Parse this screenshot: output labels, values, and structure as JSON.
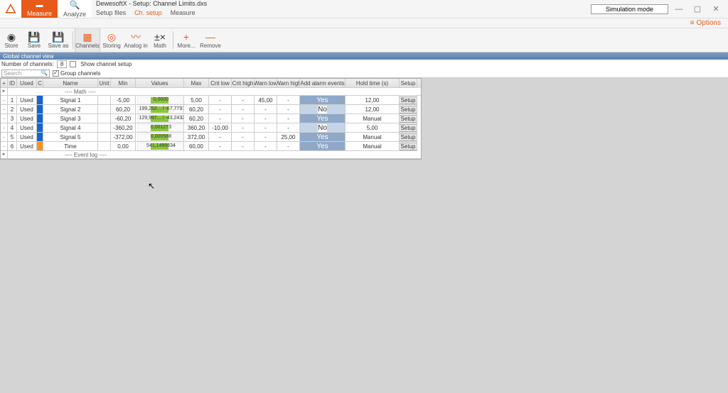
{
  "titlebar": {
    "app_title": "DewesoftX - Setup: Channel Limits.dxs",
    "measure": "Measure",
    "analyze": "Analyze",
    "setup_files": "Setup files",
    "ch_setup": "Ch. setup",
    "measure2": "Measure",
    "sim_mode": "Simulation mode",
    "options": "Options"
  },
  "toolbar": {
    "store": "Store",
    "save": "Save",
    "save_as": "Save as",
    "channels": "Channels",
    "storing": "Storing",
    "analog_in": "Analog in",
    "math": "Math",
    "more": "More...",
    "remove": "Remove"
  },
  "channel_hdr": "Global channel view",
  "controls": {
    "num_channels_lbl": "Number of channels:",
    "num_channels_val": "8",
    "show_channel_setup": "Show channel setup",
    "search_placeholder": "Search",
    "group_channels": "Group channels"
  },
  "columns": {
    "plus": "+",
    "id": "ID",
    "used": "Used",
    "c": "C",
    "name": "Name",
    "unit": "Unit",
    "min": "Min",
    "values": "Values",
    "max": "Max",
    "crit_low": "Crit low",
    "crit_high": "Crit high",
    "warn_low": "Warn low",
    "warn_high": "Warn high",
    "add_alarm": "Add alarm events",
    "hold": "Hold time (s)",
    "setup": "Setup"
  },
  "groups": {
    "math": "---- Math ----",
    "event_log": "---- Event log ----"
  },
  "rows": [
    {
      "id": "1",
      "used": "Used",
      "color": "blue",
      "name": "Signal 1",
      "unit": "",
      "min": "-5,00",
      "val": "0,0000",
      "max": "5,00",
      "cl": "-",
      "ch": "-",
      "wl": "45,00",
      "wh": "-",
      "alarm": "Yes",
      "hold": "12,00",
      "setup": "Setup"
    },
    {
      "id": "2",
      "used": "Used",
      "color": "blue",
      "name": "Signal 2",
      "unit": "",
      "min": "60,20",
      "val": "199,252... / -67,7791...",
      "max": "60,20",
      "cl": "-",
      "ch": "-",
      "wl": "-",
      "wh": "-",
      "alarm": "No",
      "hold": "12,00",
      "setup": "Setup"
    },
    {
      "id": "3",
      "used": "Used",
      "color": "blue",
      "name": "Signal 3",
      "unit": "",
      "min": "-60,20",
      "val": "129,997... / -43,2432...",
      "max": "60,20",
      "cl": "-",
      "ch": "-",
      "wl": "-",
      "wh": "-",
      "alarm": "Yes",
      "hold": "Manual",
      "setup": "Setup"
    },
    {
      "id": "4",
      "used": "Used",
      "color": "blue",
      "name": "Signal 4",
      "unit": "",
      "min": "-360,20",
      "val": "0,001273",
      "max": "360,20",
      "cl": "-10,00",
      "ch": "-",
      "wl": "-",
      "wh": "-",
      "alarm": "No",
      "hold": "5,00",
      "setup": "Setup"
    },
    {
      "id": "5",
      "used": "Used",
      "color": "blue",
      "name": "Signal 5",
      "unit": "",
      "min": "-372,00",
      "val": "0,000588",
      "max": "372,00",
      "cl": "-",
      "ch": "-",
      "wl": "-",
      "wh": "25,00",
      "alarm": "Yes",
      "hold": "Manual",
      "setup": "Setup"
    },
    {
      "id": "6",
      "used": "Used",
      "color": "orange-c",
      "name": "Time",
      "unit": "",
      "min": "0,00",
      "val": "541,1495634",
      "max": "60,00",
      "cl": "-",
      "ch": "-",
      "wl": "-",
      "wh": "-",
      "alarm": "Yes",
      "hold": "Manual",
      "setup": "Setup"
    }
  ]
}
